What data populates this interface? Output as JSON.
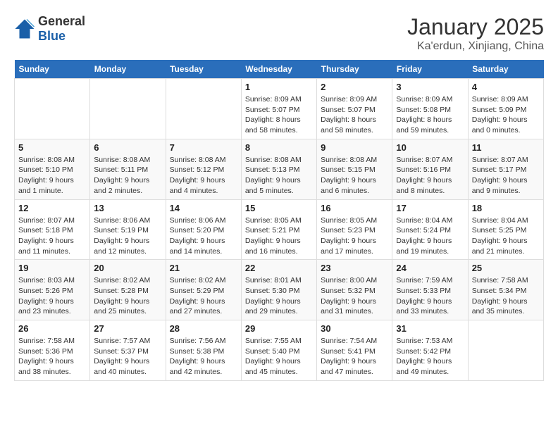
{
  "header": {
    "logo_general": "General",
    "logo_blue": "Blue",
    "title": "January 2025",
    "subtitle": "Ka'erdun, Xinjiang, China"
  },
  "days_of_week": [
    "Sunday",
    "Monday",
    "Tuesday",
    "Wednesday",
    "Thursday",
    "Friday",
    "Saturday"
  ],
  "weeks": [
    {
      "days": [
        {
          "num": "",
          "info": ""
        },
        {
          "num": "",
          "info": ""
        },
        {
          "num": "",
          "info": ""
        },
        {
          "num": "1",
          "info": "Sunrise: 8:09 AM\nSunset: 5:07 PM\nDaylight: 8 hours and 58 minutes."
        },
        {
          "num": "2",
          "info": "Sunrise: 8:09 AM\nSunset: 5:07 PM\nDaylight: 8 hours and 58 minutes."
        },
        {
          "num": "3",
          "info": "Sunrise: 8:09 AM\nSunset: 5:08 PM\nDaylight: 8 hours and 59 minutes."
        },
        {
          "num": "4",
          "info": "Sunrise: 8:09 AM\nSunset: 5:09 PM\nDaylight: 9 hours and 0 minutes."
        }
      ]
    },
    {
      "days": [
        {
          "num": "5",
          "info": "Sunrise: 8:08 AM\nSunset: 5:10 PM\nDaylight: 9 hours and 1 minute."
        },
        {
          "num": "6",
          "info": "Sunrise: 8:08 AM\nSunset: 5:11 PM\nDaylight: 9 hours and 2 minutes."
        },
        {
          "num": "7",
          "info": "Sunrise: 8:08 AM\nSunset: 5:12 PM\nDaylight: 9 hours and 4 minutes."
        },
        {
          "num": "8",
          "info": "Sunrise: 8:08 AM\nSunset: 5:13 PM\nDaylight: 9 hours and 5 minutes."
        },
        {
          "num": "9",
          "info": "Sunrise: 8:08 AM\nSunset: 5:15 PM\nDaylight: 9 hours and 6 minutes."
        },
        {
          "num": "10",
          "info": "Sunrise: 8:07 AM\nSunset: 5:16 PM\nDaylight: 9 hours and 8 minutes."
        },
        {
          "num": "11",
          "info": "Sunrise: 8:07 AM\nSunset: 5:17 PM\nDaylight: 9 hours and 9 minutes."
        }
      ]
    },
    {
      "days": [
        {
          "num": "12",
          "info": "Sunrise: 8:07 AM\nSunset: 5:18 PM\nDaylight: 9 hours and 11 minutes."
        },
        {
          "num": "13",
          "info": "Sunrise: 8:06 AM\nSunset: 5:19 PM\nDaylight: 9 hours and 12 minutes."
        },
        {
          "num": "14",
          "info": "Sunrise: 8:06 AM\nSunset: 5:20 PM\nDaylight: 9 hours and 14 minutes."
        },
        {
          "num": "15",
          "info": "Sunrise: 8:05 AM\nSunset: 5:21 PM\nDaylight: 9 hours and 16 minutes."
        },
        {
          "num": "16",
          "info": "Sunrise: 8:05 AM\nSunset: 5:23 PM\nDaylight: 9 hours and 17 minutes."
        },
        {
          "num": "17",
          "info": "Sunrise: 8:04 AM\nSunset: 5:24 PM\nDaylight: 9 hours and 19 minutes."
        },
        {
          "num": "18",
          "info": "Sunrise: 8:04 AM\nSunset: 5:25 PM\nDaylight: 9 hours and 21 minutes."
        }
      ]
    },
    {
      "days": [
        {
          "num": "19",
          "info": "Sunrise: 8:03 AM\nSunset: 5:26 PM\nDaylight: 9 hours and 23 minutes."
        },
        {
          "num": "20",
          "info": "Sunrise: 8:02 AM\nSunset: 5:28 PM\nDaylight: 9 hours and 25 minutes."
        },
        {
          "num": "21",
          "info": "Sunrise: 8:02 AM\nSunset: 5:29 PM\nDaylight: 9 hours and 27 minutes."
        },
        {
          "num": "22",
          "info": "Sunrise: 8:01 AM\nSunset: 5:30 PM\nDaylight: 9 hours and 29 minutes."
        },
        {
          "num": "23",
          "info": "Sunrise: 8:00 AM\nSunset: 5:32 PM\nDaylight: 9 hours and 31 minutes."
        },
        {
          "num": "24",
          "info": "Sunrise: 7:59 AM\nSunset: 5:33 PM\nDaylight: 9 hours and 33 minutes."
        },
        {
          "num": "25",
          "info": "Sunrise: 7:58 AM\nSunset: 5:34 PM\nDaylight: 9 hours and 35 minutes."
        }
      ]
    },
    {
      "days": [
        {
          "num": "26",
          "info": "Sunrise: 7:58 AM\nSunset: 5:36 PM\nDaylight: 9 hours and 38 minutes."
        },
        {
          "num": "27",
          "info": "Sunrise: 7:57 AM\nSunset: 5:37 PM\nDaylight: 9 hours and 40 minutes."
        },
        {
          "num": "28",
          "info": "Sunrise: 7:56 AM\nSunset: 5:38 PM\nDaylight: 9 hours and 42 minutes."
        },
        {
          "num": "29",
          "info": "Sunrise: 7:55 AM\nSunset: 5:40 PM\nDaylight: 9 hours and 45 minutes."
        },
        {
          "num": "30",
          "info": "Sunrise: 7:54 AM\nSunset: 5:41 PM\nDaylight: 9 hours and 47 minutes."
        },
        {
          "num": "31",
          "info": "Sunrise: 7:53 AM\nSunset: 5:42 PM\nDaylight: 9 hours and 49 minutes."
        },
        {
          "num": "",
          "info": ""
        }
      ]
    }
  ]
}
